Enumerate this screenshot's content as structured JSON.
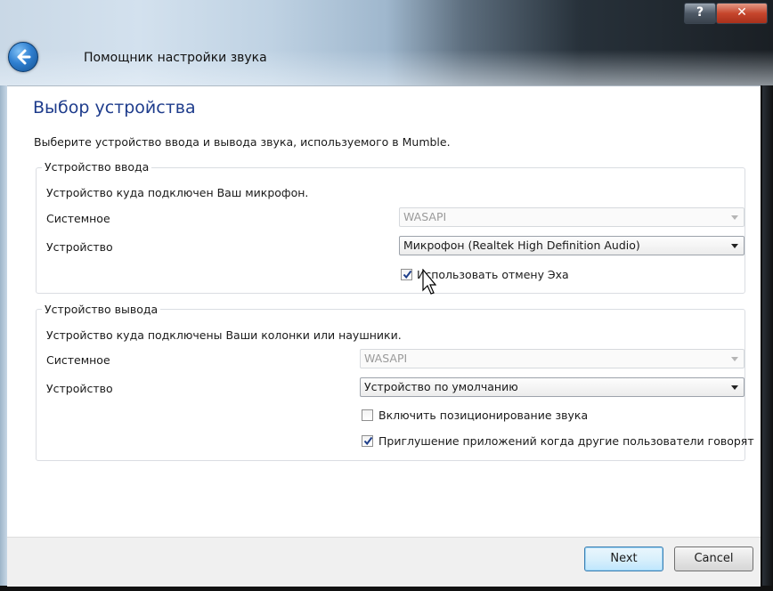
{
  "window": {
    "title": "Помощник настройки звука",
    "help_label": "?",
    "close_label": "✕"
  },
  "page": {
    "heading": "Выбор устройства",
    "description": "Выберите устройство ввода и вывода звука, используемого в Mumble."
  },
  "input": {
    "legend": "Устройство ввода",
    "description": "Устройство куда подключен Ваш микрофон.",
    "system_label": "Системное",
    "system_value": "WASAPI",
    "device_label": "Устройство",
    "device_value": "Микрофон (Realtek High Definition Audio)",
    "echo_cancel_label": "Использовать отмену Эха",
    "echo_cancel_checked": true
  },
  "output": {
    "legend": "Устройство вывода",
    "description": "Устройство куда подключены Ваши колонки или наушники.",
    "system_label": "Системное",
    "system_value": "WASAPI",
    "device_label": "Устройство",
    "device_value": "Устройство по умолчанию",
    "positional_label": "Включить позиционирование звука",
    "positional_checked": false,
    "attenuate_label": "Приглушение приложений когда другие пользователи говорят",
    "attenuate_checked": true
  },
  "footer": {
    "next_label": "Next",
    "cancel_label": "Cancel"
  }
}
